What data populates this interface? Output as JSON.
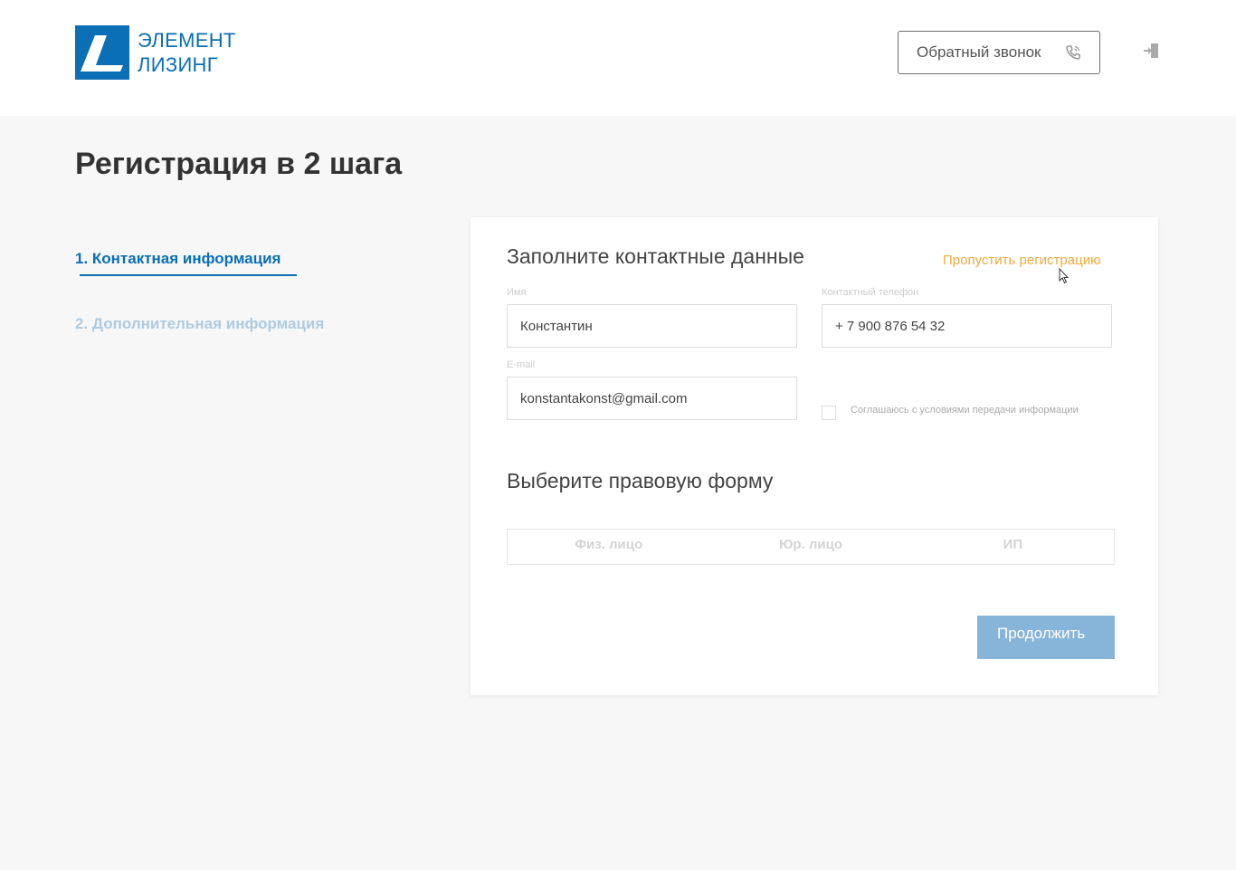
{
  "brand": {
    "name_line1": "ЭЛЕМЕНТ",
    "name_line2": "ЛИЗИНГ",
    "color": "#0a6fb4"
  },
  "header": {
    "callback_label": "Обратный звонок",
    "callback_icon": "phone-icon",
    "login_icon": "login-icon"
  },
  "page": {
    "title": "Регистрация в 2 шага"
  },
  "steps": [
    {
      "label": "1. Контактная информация",
      "active": true
    },
    {
      "label": "2. Дополнительная информация",
      "active": false
    }
  ],
  "form": {
    "contacts_title": "Заполните контактные данные",
    "skip_label": "Пропустить регистрацию",
    "fields": {
      "name": {
        "label": "Имя",
        "value": "Константин"
      },
      "phone": {
        "label": "Контактный телефон",
        "value": "+ 7 900 876 54 32"
      },
      "email": {
        "label": "E-mail",
        "value": "konstantakonst@gmail.com"
      }
    },
    "agree_label": "Соглашаюсь с условиями передачи информации",
    "agree_checked": false,
    "legal_title": "Выберите правовую форму",
    "legal_forms": [
      "Физ. лицо",
      "Юр. лицо",
      "ИП"
    ],
    "continue_label": "Продолжить"
  },
  "colors": {
    "accent": "#0a6fb4",
    "skip_link": "#f2a93b",
    "continue_button": "#87b5da",
    "inactive_step": "#aecbe2"
  }
}
